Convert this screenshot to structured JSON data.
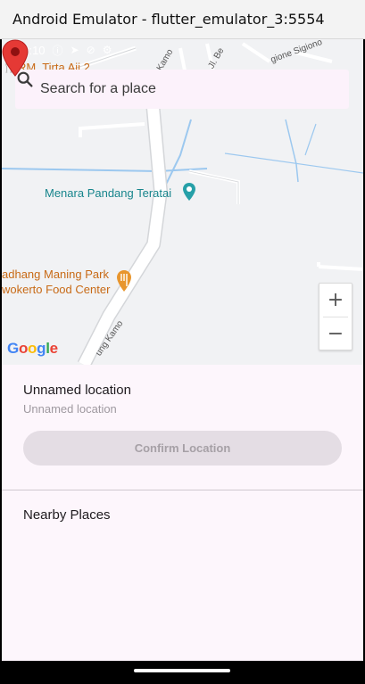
{
  "window": {
    "title": "Android Emulator - flutter_emulator_3:5554"
  },
  "status_bar": {
    "time": "10:10",
    "icons": [
      "alert-circle-icon",
      "navigation-arrow-icon",
      "do-not-disturb-icon",
      "gear-icon"
    ]
  },
  "search": {
    "placeholder": "Search for a place",
    "icon": "search-icon"
  },
  "map": {
    "poi_labels": {
      "top_restaurant": "RM. Tirta Aji 2",
      "tower": "Menara Pandang Teratai",
      "park": "adhang Maning Park",
      "food_center": "wokerto Food Center"
    },
    "street_labels": {
      "jl_be": "Jl. Be",
      "gioi": "gione Sigiono",
      "kamo_top": "Kamo",
      "kamo_bottom": "ung Kamo"
    },
    "zoom_in": "+",
    "zoom_out": "−",
    "attribution": "Google",
    "marker_color": "#e53935"
  },
  "location": {
    "name": "Unnamed location",
    "subtitle": "Unnamed location",
    "confirm_button": "Confirm Location"
  },
  "nearby": {
    "title": "Nearby Places"
  },
  "colors": {
    "background": "#fdf6fc",
    "button_disabled_bg": "#e4dde4",
    "button_disabled_text": "#a6a0a6",
    "poi_teal": "#17858c",
    "poi_orange": "#c86a16"
  }
}
